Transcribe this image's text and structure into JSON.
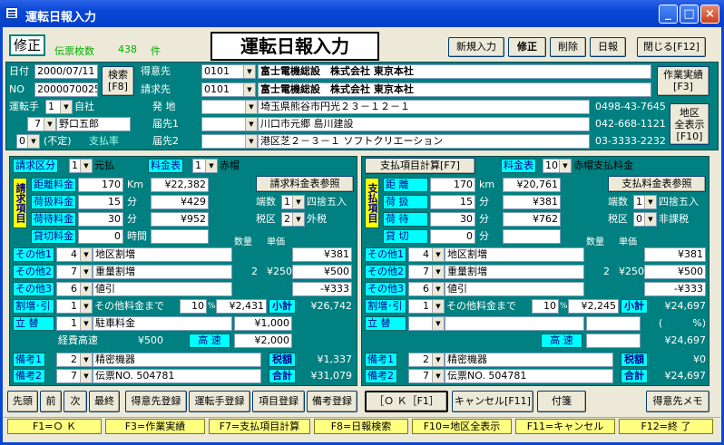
{
  "window": {
    "title": "運転日報入力",
    "min": "_",
    "max": "□",
    "close": "×"
  },
  "header": {
    "mode": "修正",
    "slip_count_label": "伝票枚数",
    "slip_count": "438",
    "slip_unit": "件",
    "big_title": "運転日報入力",
    "buttons": [
      "新規入力",
      "修正",
      "削除",
      "日報",
      "閉じる[F12]"
    ]
  },
  "top": {
    "date_label": "日付",
    "date": "2000/07/11",
    "no_label": "NO",
    "no": "2000070025",
    "search_btn": "検索\n[F8]",
    "customer_label": "得意先",
    "customer_code": "0101",
    "customer_name": "富士電機総設　株式会社 東京本社",
    "bill_label": "請求先",
    "bill_code": "0101",
    "bill_name": "富士電機総設　株式会社 東京本社",
    "work_btn": "作業実績\n[F3]",
    "area_btn": "地区\n全表示\n[F10]"
  },
  "route": {
    "driver_label": "運転手",
    "driver_type": "1",
    "driver_type_name": "自社",
    "driver_code": "7",
    "driver_name": "野口五郎",
    "pay_code": "0",
    "pay_name": "(不定)",
    "pay_rate_label": "支払率",
    "origin_label": "発 地",
    "origin": "埼玉県熊谷市円光２３－１２－１",
    "origin_tel": "0498-43-7645",
    "dest1_label": "届先1",
    "dest1": "川口市元郷 島川建設",
    "dest1_tel": "042-668-1121",
    "dest2_label": "届先2",
    "dest2": "港区芝２－３－１ ソフトクリエーション",
    "dest2_tel": "03-3333-2232"
  },
  "left": {
    "bill_cat_label": "請求区分",
    "bill_cat": "1",
    "bill_cat_name": "元払",
    "rate_table_label": "料金表",
    "rate_table": "1",
    "rate_table_name": "赤帽",
    "ref_btn": "請求料金表参照",
    "side_label": "請求項目",
    "rows": [
      {
        "label": "距離料金",
        "qty": "170",
        "unit": "Km",
        "amt": "¥22,382"
      },
      {
        "label": "荷扱料金",
        "qty": "15",
        "unit": "分",
        "amt": "¥429"
      },
      {
        "label": "荷待料金",
        "qty": "30",
        "unit": "分",
        "amt": "¥952"
      },
      {
        "label": "貸切料金",
        "qty": "0",
        "unit": "時間",
        "amt": ""
      }
    ],
    "round_label": "端数",
    "round": "1",
    "round_name": "四捨五入",
    "tax_label": "税区",
    "tax": "2",
    "tax_name": "外税",
    "qty_head": "数量",
    "price_head": "単価",
    "others": [
      {
        "label": "その他1",
        "code": "4",
        "name": "地区割増",
        "qty": "",
        "price": "",
        "amt": "¥381"
      },
      {
        "label": "その他2",
        "code": "7",
        "name": "重量割増",
        "qty": "2",
        "price": "¥250",
        "amt": "¥500"
      },
      {
        "label": "その他3",
        "code": "6",
        "name": "値引",
        "qty": "",
        "price": "",
        "amt": "-¥333"
      }
    ],
    "surcharge_label": "割増･引",
    "surcharge_code": "1",
    "surcharge_name": "その他料金まで",
    "surcharge_pct": "10",
    "pct": "%",
    "surcharge_amt": "¥2,431",
    "subtotal_label": "小計",
    "subtotal": "¥26,742",
    "advance_label": "立 替",
    "advance_code": "1",
    "advance_name": "駐車料金",
    "advance_amt": "¥1,000",
    "hw_label": "経費高速",
    "hw_val": "¥500",
    "hw_label2": "高 速",
    "hw_amt": "¥2,000",
    "tax_total_label": "税額",
    "tax_total": "¥1,337",
    "total_label": "合計",
    "total": "¥31,079"
  },
  "right": {
    "calc_btn": "支払項目計算[F7]",
    "rate_table_label": "料金表",
    "rate_table": "10",
    "rate_table_name": "赤帽支払料金",
    "ref_btn": "支払料金表参照",
    "side_label": "支払項目",
    "rows": [
      {
        "label": "距 離",
        "qty": "170",
        "unit": "km",
        "amt": "¥20,761"
      },
      {
        "label": "荷 扱",
        "qty": "15",
        "unit": "分",
        "amt": "¥381"
      },
      {
        "label": "荷 待",
        "qty": "30",
        "unit": "分",
        "amt": "¥762"
      },
      {
        "label": "貸 切",
        "qty": "0",
        "unit": "分",
        "amt": ""
      }
    ],
    "round_label": "端数",
    "round": "1",
    "round_name": "四捨五入",
    "tax_label": "税区",
    "tax": "0",
    "tax_name": "非課税",
    "qty_head": "数量",
    "price_head": "単価",
    "others": [
      {
        "label": "その他1",
        "code": "4",
        "name": "地区割増",
        "qty": "",
        "price": "",
        "amt": "¥381"
      },
      {
        "label": "その他2",
        "code": "7",
        "name": "重量割増",
        "qty": "2",
        "price": "¥250",
        "amt": "¥500"
      },
      {
        "label": "その他3",
        "code": "6",
        "name": "値引",
        "qty": "",
        "price": "",
        "amt": "-¥333"
      }
    ],
    "surcharge_label": "割増･引",
    "surcharge_code": "1",
    "surcharge_name": "その他料金まで",
    "surcharge_pct": "10",
    "pct": "%",
    "surcharge_amt": "¥2,245",
    "subtotal_label": "小計",
    "subtotal": "¥24,697",
    "advance_label": "立 替",
    "paren": "(　　　%)",
    "sub2": "¥24,697",
    "hw_label2": "高 速",
    "hw_total": "¥24,697",
    "tax_total_label": "税額",
    "tax_total": "¥0",
    "total_label": "合計",
    "total": "¥24,697"
  },
  "notes": {
    "label1": "備考1",
    "code1": "2",
    "text1": "精密機器",
    "label2": "備考2",
    "code2": "7",
    "text2": "伝票NO. 504781",
    "rlabel1": "備考1",
    "rcode1": "2",
    "rtext1": "精密機器",
    "rlabel2": "備考2",
    "rcode2": "7",
    "rtext2": "伝票NO. 504781"
  },
  "bottom": {
    "nav": [
      "先頭",
      "前",
      "次",
      "最終"
    ],
    "reg": [
      "得意先登録",
      "運転手登録",
      "項目登録",
      "備考登録"
    ],
    "ok": "［Ｏ Ｋ［F1］",
    "cancel": "キャンセル[F11]",
    "tag": "付箋",
    "memo": "得意先メモ"
  },
  "status": [
    "F1=Ｏ Ｋ",
    "F3=作業実績",
    "F7=支払項目計算",
    "F8=日報検索",
    "F10=地区全表示",
    "F11=キャンセル",
    "F12=終 了"
  ]
}
